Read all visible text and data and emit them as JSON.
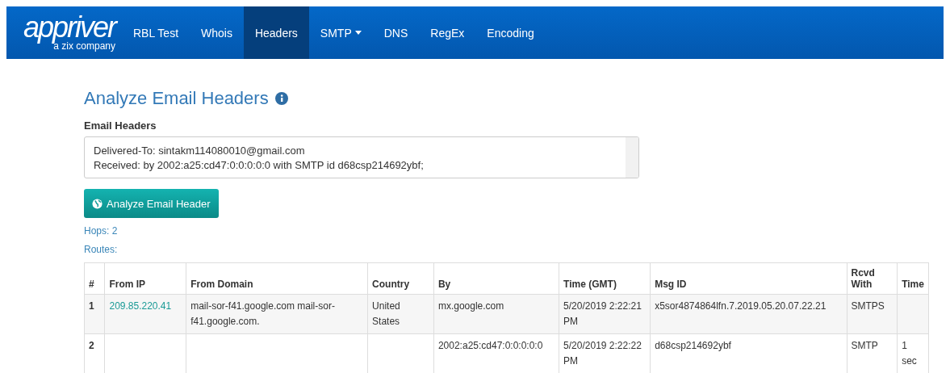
{
  "navbar": {
    "logo": {
      "wordmark": "appriver",
      "tagline": "a zix company"
    },
    "items": [
      {
        "label": "RBL Test",
        "selected": false,
        "dropdown": false
      },
      {
        "label": "Whois",
        "selected": false,
        "dropdown": false
      },
      {
        "label": "Headers",
        "selected": true,
        "dropdown": false
      },
      {
        "label": "SMTP",
        "selected": false,
        "dropdown": true
      },
      {
        "label": "DNS",
        "selected": false,
        "dropdown": false
      },
      {
        "label": "RegEx",
        "selected": false,
        "dropdown": false
      },
      {
        "label": "Encoding",
        "selected": false,
        "dropdown": false
      }
    ]
  },
  "title": "Analyze Email Headers",
  "field_label": "Email Headers",
  "headers_field": {
    "lines": [
      "Delivered-To: sintakm114080010@gmail.com",
      "Received: by 2002:a25:cd47:0:0:0:0:0 with SMTP id d68csp214692ybf;"
    ]
  },
  "analyze_button": "Analyze Email Header",
  "hops": "Hops: 2",
  "routes": "Routes:",
  "table": {
    "columns": [
      "#",
      "From IP",
      "From Domain",
      "Country",
      "By",
      "Time (GMT)",
      "Msg ID",
      "Rcvd With",
      "Time"
    ],
    "rows": [
      [
        "1",
        "209.85.220.41",
        "mail-sor-f41.google.com mail-sor-f41.google.com.",
        "United States",
        "mx.google.com",
        "5/20/2019 2:22:21 PM",
        "x5sor4874864lfn.7.2019.05.20.07.22.21",
        "SMTPS",
        ""
      ],
      [
        "2",
        "",
        "",
        "",
        "2002:a25:cd47:0:0:0:0:0",
        "5/20/2019 2:22:22 PM",
        "d68csp214692ybf",
        "SMTP",
        "1 sec"
      ]
    ]
  }
}
